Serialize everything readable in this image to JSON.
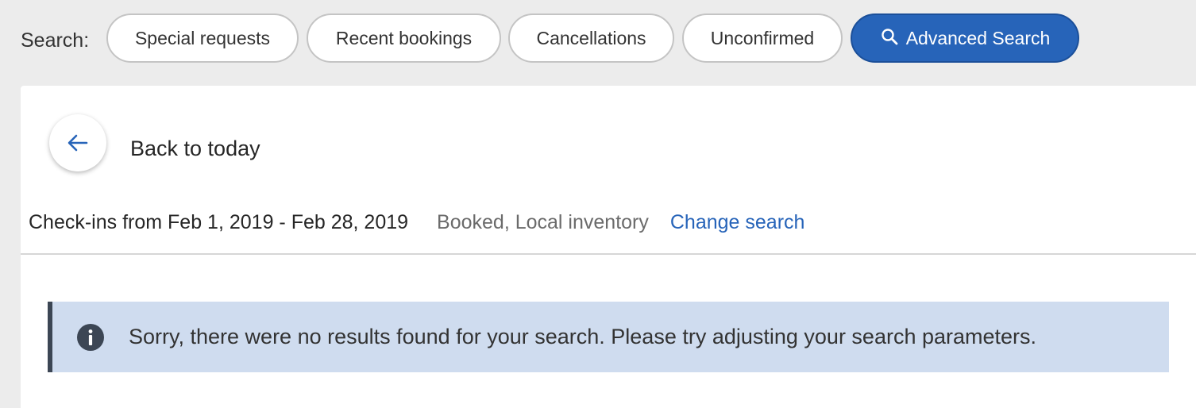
{
  "search": {
    "label": "Search:",
    "pills": [
      {
        "label": "Special requests"
      },
      {
        "label": "Recent bookings"
      },
      {
        "label": "Cancellations"
      },
      {
        "label": "Unconfirmed"
      }
    ],
    "advanced": {
      "label": "Advanced Search",
      "icon": "search-icon"
    }
  },
  "panel": {
    "back": {
      "label": "Back to today",
      "icon": "arrow-left-icon"
    },
    "summary": {
      "date_range": "Check-ins from Feb 1, 2019 - Feb 28, 2019",
      "filters": "Booked, Local inventory",
      "change_link": "Change search"
    },
    "alert": {
      "icon": "info-icon",
      "message": "Sorry, there were no results found for your search. Please try adjusting your search parameters."
    }
  },
  "colors": {
    "accent": "#2764b9",
    "page_background": "#ececec",
    "alert_background": "#cfdcef",
    "alert_border": "#3c4654"
  }
}
